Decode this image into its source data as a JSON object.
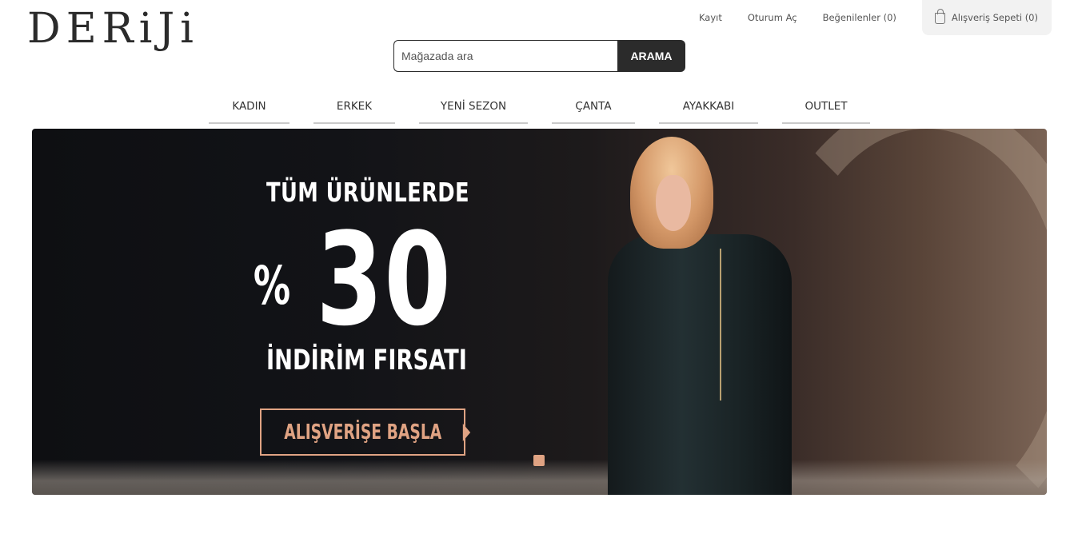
{
  "brand": {
    "logo": "DERiJi"
  },
  "topbar": {
    "register": "Kayıt",
    "login": "Oturum Aç",
    "favorites": "Beğenilenler (0)",
    "cart": "Alışveriş Sepeti (0)",
    "cart_icon": "shopping-bag-icon"
  },
  "search": {
    "placeholder": "Mağazada ara",
    "button": "ARAMA"
  },
  "nav": {
    "items": [
      {
        "label": "KADIN"
      },
      {
        "label": "ERKEK"
      },
      {
        "label": "YENİ SEZON"
      },
      {
        "label": "ÇANTA"
      },
      {
        "label": "AYAKKABI"
      },
      {
        "label": "OUTLET"
      }
    ]
  },
  "hero": {
    "line1": "TÜM ÜRÜNLERDE",
    "percent": "%",
    "number": "30",
    "line3": "İNDİRİM FIRSATI",
    "cta": "ALIŞVERİŞE BAŞLA",
    "accent_color": "#e0a383"
  }
}
